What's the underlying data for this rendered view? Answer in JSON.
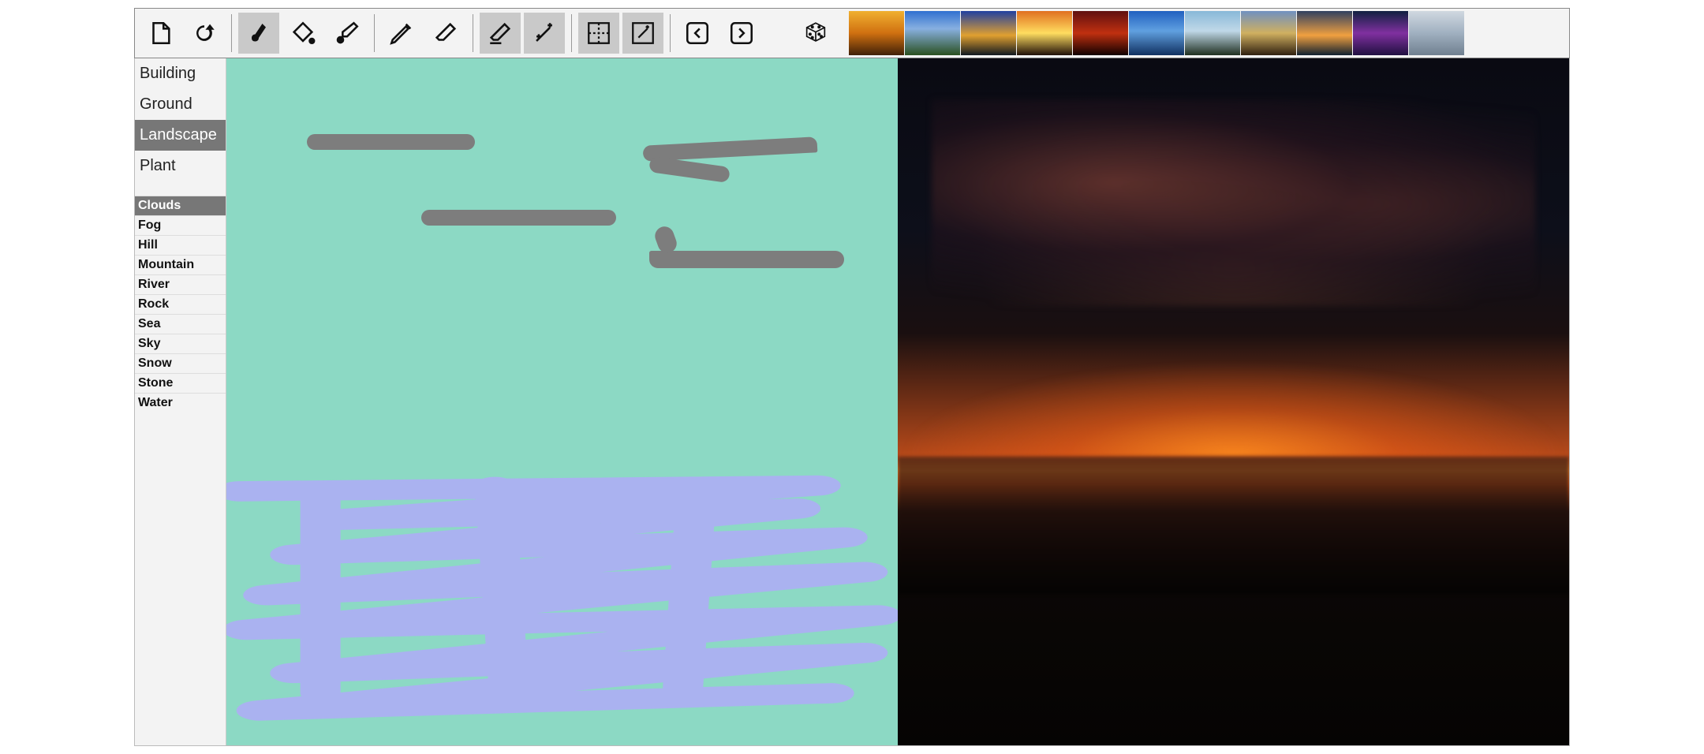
{
  "toolbar": {
    "tools": [
      {
        "name": "new-canvas",
        "group": 0
      },
      {
        "name": "reload",
        "group": 0
      },
      {
        "name": "brush",
        "group": 1,
        "active": true
      },
      {
        "name": "fill",
        "group": 1
      },
      {
        "name": "eyedropper",
        "group": 1
      },
      {
        "name": "pencil",
        "group": 2
      },
      {
        "name": "eraser",
        "group": 2
      },
      {
        "name": "erase-area",
        "group": 3,
        "active": true
      },
      {
        "name": "magic-wand",
        "group": 3,
        "active": true
      },
      {
        "name": "select-grid",
        "group": 4,
        "active": true
      },
      {
        "name": "select-magic",
        "group": 4,
        "active": true
      },
      {
        "name": "nav-prev",
        "group": 5
      },
      {
        "name": "nav-next",
        "group": 5
      }
    ],
    "random_style": "random-style"
  },
  "style_thumbs": [
    {
      "name": "style-1"
    },
    {
      "name": "style-2"
    },
    {
      "name": "style-3"
    },
    {
      "name": "style-4"
    },
    {
      "name": "style-5"
    },
    {
      "name": "style-6"
    },
    {
      "name": "style-7"
    },
    {
      "name": "style-8"
    },
    {
      "name": "style-9"
    },
    {
      "name": "style-10"
    },
    {
      "name": "style-11"
    }
  ],
  "sidebar": {
    "categories": [
      {
        "label": "Building"
      },
      {
        "label": "Ground"
      },
      {
        "label": "Landscape",
        "active": true
      },
      {
        "label": "Plant"
      }
    ],
    "subcategories": [
      {
        "label": "Clouds",
        "active": true
      },
      {
        "label": "Fog"
      },
      {
        "label": "Hill"
      },
      {
        "label": "Mountain"
      },
      {
        "label": "River"
      },
      {
        "label": "Rock"
      },
      {
        "label": "Sea"
      },
      {
        "label": "Sky"
      },
      {
        "label": "Snow"
      },
      {
        "label": "Stone"
      },
      {
        "label": "Water"
      }
    ]
  },
  "canvas": {
    "seg_background_color": "#8cd9c4",
    "strokes_gray": "clouds-label",
    "strokes_blue": "water-label"
  }
}
